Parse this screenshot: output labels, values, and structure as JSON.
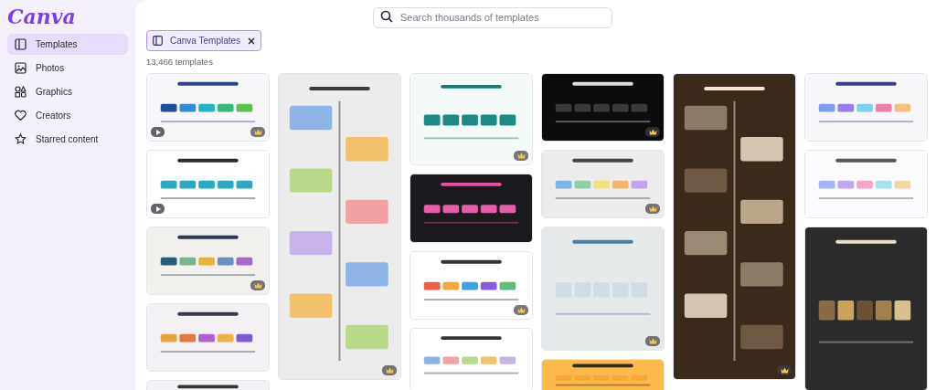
{
  "logo": "Canva",
  "sidebar": {
    "items": [
      {
        "label": "Templates",
        "selected": true
      },
      {
        "label": "Photos",
        "selected": false
      },
      {
        "label": "Graphics",
        "selected": false
      },
      {
        "label": "Creators",
        "selected": false
      },
      {
        "label": "Starred content",
        "selected": false
      }
    ]
  },
  "search": {
    "placeholder": "Search thousands of templates"
  },
  "filter_chip": {
    "label": "Canva Templates"
  },
  "result_count": "13,466 templates",
  "columns": [
    [
      {
        "kind": "picture",
        "video": true,
        "premium": true
      },
      {
        "kind": "picture",
        "video": true,
        "premium": false
      },
      {
        "kind": "picture",
        "video": false,
        "premium": true
      },
      {
        "kind": "picture",
        "video": false,
        "premium": false
      },
      {
        "kind": "picture",
        "video": false,
        "premium": false
      }
    ],
    [
      {
        "kind": "picture",
        "video": false,
        "premium": true
      }
    ],
    [
      {
        "kind": "picture",
        "video": false,
        "premium": true
      },
      {
        "kind": "picture",
        "video": false,
        "premium": false
      },
      {
        "kind": "picture",
        "video": false,
        "premium": true
      },
      {
        "kind": "picture",
        "video": false,
        "premium": false
      }
    ],
    [
      {
        "kind": "picture",
        "video": false,
        "premium": true
      },
      {
        "kind": "picture",
        "video": false,
        "premium": true
      },
      {
        "kind": "picture",
        "video": false,
        "premium": true
      },
      {
        "kind": "picture",
        "video": false,
        "premium": false
      }
    ],
    [
      {
        "kind": "picture",
        "video": false,
        "premium": true
      }
    ],
    [
      {
        "kind": "picture",
        "video": false,
        "premium": false
      },
      {
        "kind": "picture",
        "video": false,
        "premium": false
      },
      {
        "kind": "picture",
        "video": false,
        "premium": false
      }
    ]
  ]
}
